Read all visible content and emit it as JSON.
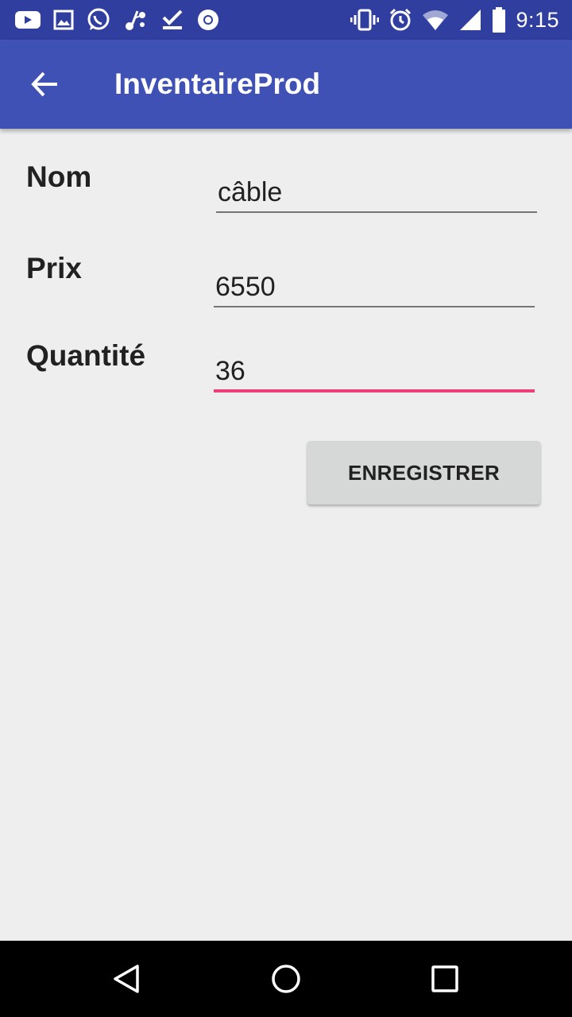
{
  "status_bar": {
    "time": "9:15",
    "left_icons": [
      "youtube-icon",
      "image-icon",
      "whatsapp-icon",
      "music-share-icon",
      "download-done-icon",
      "chrome-icon"
    ],
    "right_icons": [
      "vibrate-icon",
      "alarm-icon",
      "wifi-icon",
      "signal-icon",
      "battery-icon"
    ]
  },
  "app_bar": {
    "title": "InventaireProd",
    "color": "#3f51b5",
    "status_color": "#303f9f"
  },
  "form": {
    "fields": [
      {
        "label": "Nom",
        "value": "câble"
      },
      {
        "label": "Prix",
        "value": "6550"
      },
      {
        "label": "Quantité",
        "value": "36"
      }
    ],
    "focused_field": "Quantité",
    "accent_color": "#ec407a",
    "save_label": "ENREGISTRER"
  },
  "nav_bar": {
    "buttons": [
      "back-triangle-icon",
      "home-circle-icon",
      "recents-square-icon"
    ]
  }
}
